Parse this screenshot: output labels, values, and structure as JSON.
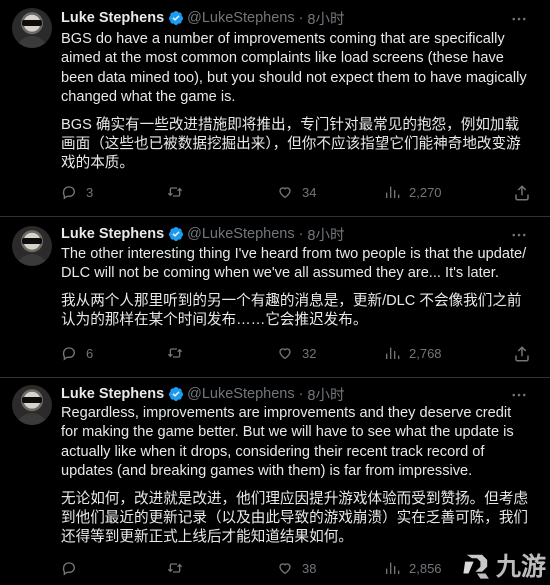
{
  "tweets": [
    {
      "author_name": "Luke Stephens",
      "handle": "@LukeStephens",
      "separator": "·",
      "time": "8小时",
      "text_en": "BGS do have a number of improvements coming that are specifically aimed at the most common complaints like load screens (these have been data mined too), but you should not expect them to have magically changed what the game is.",
      "text_zh": "BGS 确实有一些改进措施即将推出，专门针对最常见的抱怨，例如加载画面（这些也已被数据挖掘出来），但你不应该指望它们能神奇地改变游戏的本质。",
      "replies": "3",
      "retweets": "",
      "likes": "34",
      "views": "2,270"
    },
    {
      "author_name": "Luke Stephens",
      "handle": "@LukeStephens",
      "separator": "·",
      "time": "8小时",
      "text_en": "The other interesting thing I've heard from two people is that the update/ DLC will not be coming when we've all assumed they are... It's later.",
      "text_zh": "我从两个人那里听到的另一个有趣的消息是，更新/DLC 不会像我们之前认为的那样在某个时间发布……它会推迟发布。",
      "replies": "6",
      "retweets": "",
      "likes": "32",
      "views": "2,768"
    },
    {
      "author_name": "Luke Stephens",
      "handle": "@LukeStephens",
      "separator": "·",
      "time": "8小时",
      "text_en": "Regardless, improvements are improvements and they deserve credit for making the game better. But we will have to see what the update is actually like when it drops, considering their recent track record of updates (and breaking games with them) is far from impressive.",
      "text_zh": "无论如何，改进就是改进，他们理应因提升游戏体验而受到赞扬。但考虑到他们最近的更新记录（以及由此导致的游戏崩溃）实在乏善可陈，我们还得等到更新正式上线后才能知道结果如何。",
      "replies": "",
      "retweets": "",
      "likes": "38",
      "views": "2,856"
    }
  ],
  "watermark": {
    "text": "九游"
  },
  "colors": {
    "background": "#000000",
    "text": "#e7e9ea",
    "muted": "#71767b",
    "verified": "#1d9bf0",
    "divider": "#2f3336"
  }
}
